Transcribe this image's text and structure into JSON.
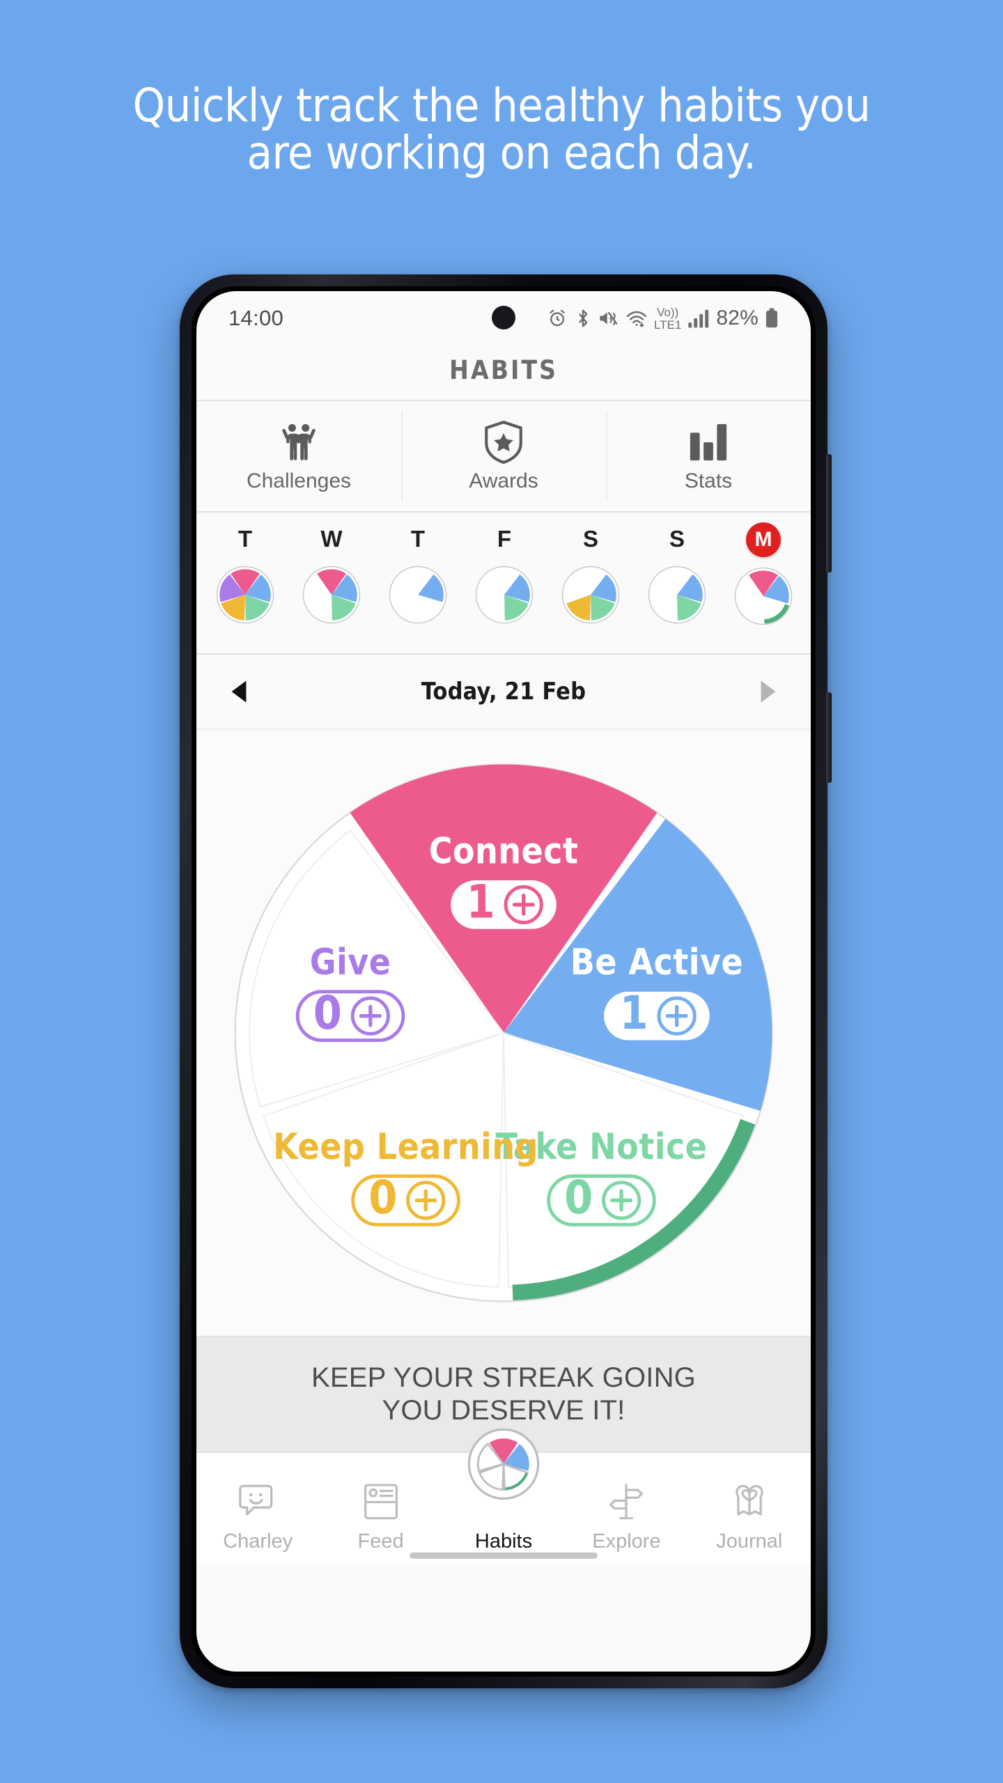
{
  "promo": {
    "headline_line1": "Quickly track the healthy habits you",
    "headline_line2": "are working on each day.",
    "background_color": "#6CA6EC"
  },
  "status_bar": {
    "time": "14:00",
    "battery_percent": "82%",
    "network_label": "LTE1",
    "volte_label": "Vo))",
    "icons": [
      "alarm-icon",
      "bluetooth-icon",
      "mute-vibrate-icon",
      "wifi-icon",
      "volte-icon",
      "signal-bars-icon",
      "battery-icon"
    ]
  },
  "app": {
    "title": "HABITS"
  },
  "tabs": [
    {
      "label": "Challenges",
      "icon": "people-raising-arms-icon"
    },
    {
      "label": "Awards",
      "icon": "shield-star-icon"
    },
    {
      "label": "Stats",
      "icon": "bar-chart-icon"
    }
  ],
  "week": {
    "days": [
      {
        "letter": "T",
        "today": false,
        "segments": {
          "connect": true,
          "be_active": true,
          "take_notice": true,
          "keep_learning": true,
          "give": true
        },
        "arc": null
      },
      {
        "letter": "W",
        "today": false,
        "segments": {
          "connect": true,
          "be_active": true,
          "take_notice": true,
          "keep_learning": false,
          "give": false
        },
        "arc": null
      },
      {
        "letter": "T",
        "today": false,
        "segments": {
          "connect": false,
          "be_active": true,
          "take_notice": false,
          "keep_learning": false,
          "give": false
        },
        "arc": null
      },
      {
        "letter": "F",
        "today": false,
        "segments": {
          "connect": false,
          "be_active": true,
          "take_notice": true,
          "keep_learning": false,
          "give": false
        },
        "arc": null
      },
      {
        "letter": "S",
        "today": false,
        "segments": {
          "connect": false,
          "be_active": true,
          "take_notice": true,
          "keep_learning": true,
          "give": false
        },
        "arc": null
      },
      {
        "letter": "S",
        "today": false,
        "segments": {
          "connect": false,
          "be_active": true,
          "take_notice": true,
          "keep_learning": false,
          "give": false
        },
        "arc": null
      },
      {
        "letter": "M",
        "today": true,
        "segments": {
          "connect": true,
          "be_active": true,
          "take_notice": false,
          "keep_learning": false,
          "give": false
        },
        "arc": "take_notice"
      }
    ]
  },
  "date_nav": {
    "label": "Today, 21 Feb",
    "prev_icon": "triangle-left-icon",
    "next_icon": "triangle-right-icon",
    "prev_enabled": true,
    "next_enabled": false
  },
  "chart_data": {
    "type": "pie",
    "title": "Today, 21 Feb",
    "legend": "inline-labels",
    "total_segments": 5,
    "segment_degrees": 72,
    "categories": [
      "Connect",
      "Be Active",
      "Take Notice",
      "Keep Learning",
      "Give"
    ],
    "values": [
      1,
      1,
      0,
      0,
      0
    ],
    "colors": [
      "#ED5B8E",
      "#74AEF0",
      "#7ED6A5",
      "#EFB936",
      "#A97BE8"
    ],
    "filled": [
      true,
      true,
      false,
      false,
      false
    ],
    "progress_arc": {
      "category": "Take Notice",
      "color": "#4FAE7E",
      "start_deg": 144,
      "end_deg": 216
    },
    "segments": [
      {
        "name": "Connect",
        "count": "1",
        "color": "#ED5B8E",
        "filled": true,
        "label_color": "#FFFFFF",
        "pill_bg": "#FFFFFF",
        "pill_fg": "#ED5B8E"
      },
      {
        "name": "Be Active",
        "count": "1",
        "color": "#74AEF0",
        "filled": true,
        "label_color": "#FFFFFF",
        "pill_bg": "#FFFFFF",
        "pill_fg": "#74AEF0"
      },
      {
        "name": "Take Notice",
        "count": "0",
        "color": "#7ED6A5",
        "filled": false,
        "label_color": "#7ED6A5",
        "pill_bg": "transparent",
        "pill_fg": "#7ED6A5"
      },
      {
        "name": "Keep Learning",
        "count": "0",
        "color": "#EFB936",
        "filled": false,
        "label_color": "#EFB936",
        "pill_bg": "transparent",
        "pill_fg": "#EFB936"
      },
      {
        "name": "Give",
        "count": "0",
        "color": "#A97BE8",
        "filled": false,
        "label_color": "#A97BE8",
        "pill_bg": "transparent",
        "pill_fg": "#A97BE8"
      }
    ]
  },
  "streak": {
    "line1": "KEEP YOUR STREAK GOING",
    "line2": "YOU DESERVE IT!"
  },
  "bottom_nav": {
    "items": [
      {
        "label": "Charley",
        "icon": "chat-smiley-icon",
        "active": false
      },
      {
        "label": "Feed",
        "icon": "feed-card-icon",
        "active": false
      },
      {
        "label": "Habits",
        "icon": "pie-habits-icon",
        "active": true
      },
      {
        "label": "Explore",
        "icon": "signpost-icon",
        "active": false
      },
      {
        "label": "Journal",
        "icon": "book-heart-icon",
        "active": false
      }
    ]
  }
}
